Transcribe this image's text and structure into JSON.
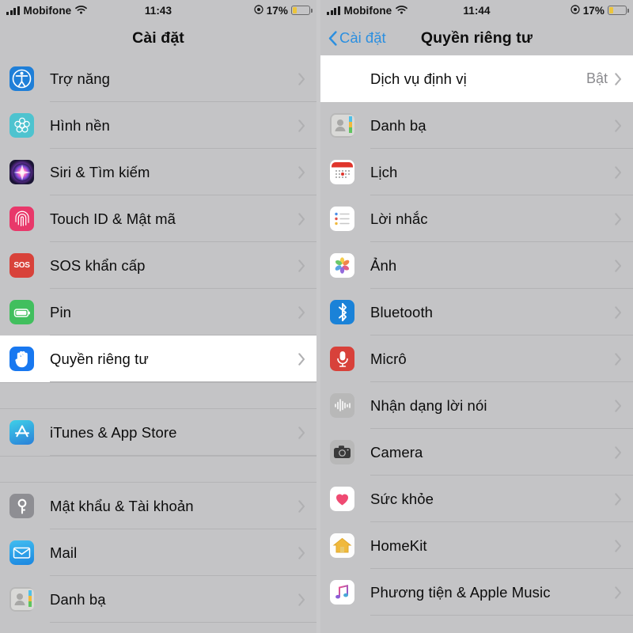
{
  "left_phone": {
    "status_bar": {
      "carrier": "Mobifone",
      "time": "11:43",
      "battery": "17%"
    },
    "nav": {
      "title": "Cài đặt"
    },
    "groups": [
      {
        "items": [
          {
            "label": "Trợ năng",
            "icon": "accessibility-icon",
            "icon_class": "acc",
            "highlighted": false
          },
          {
            "label": "Hình nền",
            "icon": "wallpaper-icon",
            "icon_class": "wall",
            "highlighted": false
          },
          {
            "label": "Siri & Tìm kiếm",
            "icon": "siri-icon",
            "icon_class": "siri",
            "highlighted": false
          },
          {
            "label": "Touch ID & Mật mã",
            "icon": "fingerprint-icon",
            "icon_class": "touch",
            "highlighted": false
          },
          {
            "label": "SOS khẩn cấp",
            "icon": "sos-icon",
            "icon_class": "sos",
            "highlighted": false
          },
          {
            "label": "Pin",
            "icon": "battery-icon",
            "icon_class": "pin",
            "highlighted": false
          },
          {
            "label": "Quyền riêng tư",
            "icon": "hand-privacy-icon",
            "icon_class": "priv",
            "highlighted": true
          }
        ]
      },
      {
        "items": [
          {
            "label": "iTunes & App Store",
            "icon": "app-store-icon",
            "icon_class": "itunes",
            "highlighted": false
          }
        ]
      },
      {
        "items": [
          {
            "label": "Mật khẩu & Tài khoản",
            "icon": "key-icon",
            "icon_class": "key",
            "highlighted": false
          },
          {
            "label": "Mail",
            "icon": "mail-envelope-icon",
            "icon_class": "mail",
            "highlighted": false
          },
          {
            "label": "Danh bạ",
            "icon": "contacts-icon",
            "icon_class": "contacts",
            "highlighted": false
          }
        ]
      }
    ]
  },
  "right_phone": {
    "status_bar": {
      "carrier": "Mobifone",
      "time": "11:44",
      "battery": "17%"
    },
    "nav": {
      "back_label": "Cài đặt",
      "title": "Quyền riêng tư"
    },
    "items": [
      {
        "label": "Dịch vụ định vị",
        "value": "Bật",
        "icon": "location-arrow-icon",
        "icon_class": "loc",
        "highlighted": true
      },
      {
        "label": "Danh bạ",
        "value": "",
        "icon": "contacts-icon",
        "icon_class": "contacts",
        "highlighted": false
      },
      {
        "label": "Lịch",
        "value": "",
        "icon": "calendar-icon",
        "icon_class": "cal",
        "highlighted": false
      },
      {
        "label": "Lời nhắc",
        "value": "",
        "icon": "reminders-icon",
        "icon_class": "remind",
        "highlighted": false
      },
      {
        "label": "Ảnh",
        "value": "",
        "icon": "photos-icon",
        "icon_class": "photos",
        "highlighted": false
      },
      {
        "label": "Bluetooth",
        "value": "",
        "icon": "bluetooth-icon",
        "icon_class": "bt",
        "highlighted": false
      },
      {
        "label": "Micrô",
        "value": "",
        "icon": "microphone-icon",
        "icon_class": "mic",
        "highlighted": false
      },
      {
        "label": "Nhận dạng lời nói",
        "value": "",
        "icon": "speech-waveform-icon",
        "icon_class": "speech",
        "highlighted": false
      },
      {
        "label": "Camera",
        "value": "",
        "icon": "camera-icon",
        "icon_class": "camera",
        "highlighted": false
      },
      {
        "label": "Sức khỏe",
        "value": "",
        "icon": "heart-health-icon",
        "icon_class": "health",
        "highlighted": false
      },
      {
        "label": "HomeKit",
        "value": "",
        "icon": "home-icon",
        "icon_class": "home",
        "highlighted": false
      },
      {
        "label": "Phương tiện & Apple Music",
        "value": "",
        "icon": "music-note-icon",
        "icon_class": "music",
        "highlighted": false
      }
    ]
  },
  "colors": {
    "accent_blue": "#2b8fe0",
    "background_gray": "#c4c4c6",
    "highlight_white": "#ffffff",
    "battery_yellow": "#ecc53c",
    "value_gray": "#8a8a8e"
  }
}
